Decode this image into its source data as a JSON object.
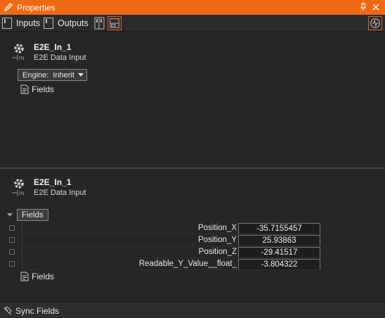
{
  "window": {
    "title": "Properties"
  },
  "toolbar": {
    "inputs_label": "Inputs",
    "outputs_label": "Outputs"
  },
  "node_top": {
    "name": "E2E_In_1",
    "type": "E2E Data Input",
    "engine_label": "Engine:",
    "engine_value": "Inherit",
    "fields_link": "Fields"
  },
  "node_bottom": {
    "name": "E2E_In_1",
    "type": "E2E Data Input",
    "fields_header": "Fields",
    "fields": [
      {
        "label": "Position_X",
        "value": "-35.7155457"
      },
      {
        "label": "Position_Y",
        "value": "25.93863"
      },
      {
        "label": "Position_Z",
        "value": "-29.41517"
      },
      {
        "label": "Readable_Y_Value__float_",
        "value": "-3.804322"
      }
    ],
    "fields_link": "Fields"
  },
  "statusbar": {
    "sync_label": "Sync Fields"
  },
  "colors": {
    "accent": "#f06a14",
    "background": "#262626",
    "selected_border": "#e8601a"
  },
  "icons": [
    "pencil-icon",
    "pin-icon",
    "close-icon",
    "gear-icon",
    "document-icon",
    "sync-icon",
    "monitor-icon"
  ]
}
